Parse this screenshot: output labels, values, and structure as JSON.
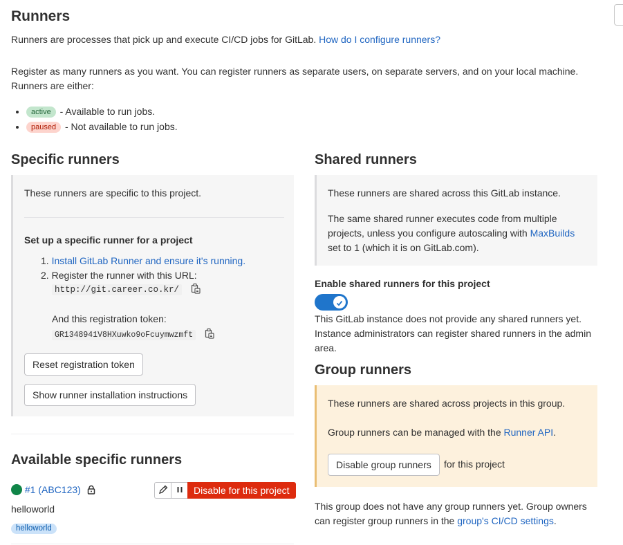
{
  "header": {
    "title": "Runners",
    "intro_text": "Runners are processes that pick up and execute CI/CD jobs for GitLab.",
    "help_link": "How do I configure runners?",
    "register_line1": "Register as many runners as you want. You can register runners as separate users, on separate servers, and on your local machine.",
    "register_line2": "Runners are either:",
    "states": [
      {
        "badge": "active",
        "text": "- Available to run jobs."
      },
      {
        "badge": "paused",
        "text": "- Not available to run jobs."
      }
    ]
  },
  "specific": {
    "title": "Specific runners",
    "description": "These runners are specific to this project.",
    "setup_title": "Set up a specific runner for a project",
    "step1_prefix": "1.",
    "step1_link": "Install GitLab Runner and ensure it's running.",
    "step2_prefix": "2.",
    "step2_text": "Register the runner with this URL:",
    "url": "http://git.career.co.kr/",
    "token_label": "And this registration token:",
    "token": "GR1348941V8HXuwko9oFcuymwzmft",
    "reset_button": "Reset registration token",
    "show_instructions_button": "Show runner installation instructions"
  },
  "available": {
    "title": "Available specific runners",
    "runner": {
      "id_label": "#1 (ABC123)",
      "name": "helloworld",
      "tag": "helloworld",
      "disable_button": "Disable for this project",
      "status_color": "#108548"
    }
  },
  "shared": {
    "title": "Shared runners",
    "description": "These runners are shared across this GitLab instance.",
    "detail_pre": "The same shared runner executes code from multiple projects, unless you configure autoscaling with",
    "detail_link": "MaxBuilds",
    "detail_post": "set to 1 (which it is on GitLab.com).",
    "enable_label": "Enable shared runners for this project",
    "toggle_on": true,
    "none_line1": "This GitLab instance does not provide any shared runners yet.",
    "none_line2": "Instance administrators can register shared runners in the admin",
    "none_line3": "area."
  },
  "group": {
    "title": "Group runners",
    "description": "These runners are shared across projects in this group.",
    "manage_pre": "Group runners can be managed with the",
    "manage_link": "Runner API",
    "manage_post": ".",
    "disable_button": "Disable group runners",
    "disable_suffix": "for this project",
    "none_line1": "This group does not have any group runners yet. Group owners",
    "none_line2_pre": "can register group runners in the",
    "none_line2_link": "group's CI/CD settings",
    "none_line2_post": "."
  },
  "colors": {
    "accent": "#1f75cb",
    "danger": "#dd2b0e",
    "success": "#108548",
    "warning_bg": "#fdf1dd"
  }
}
